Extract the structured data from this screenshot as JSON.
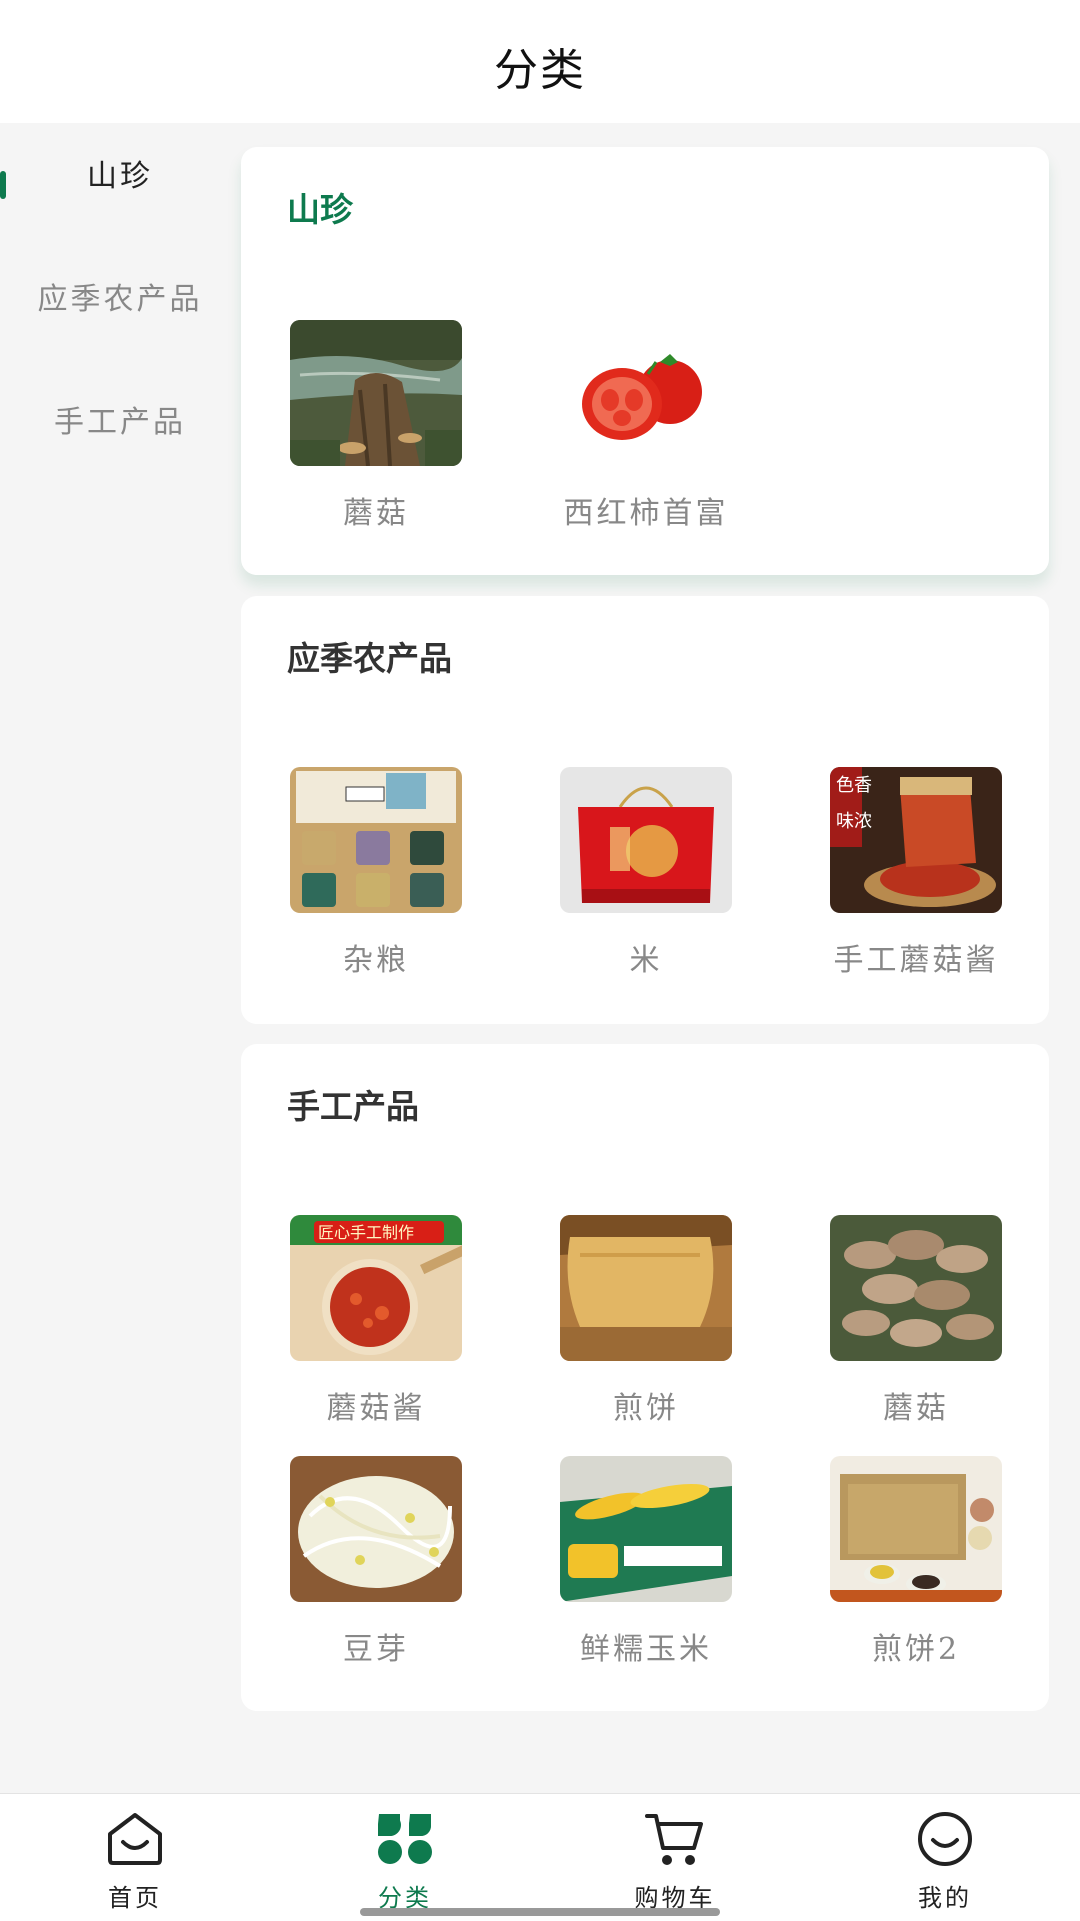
{
  "header": {
    "title": "分类"
  },
  "sidebar": {
    "items": [
      {
        "label": "山珍",
        "active": true
      },
      {
        "label": "应季农产品",
        "active": false
      },
      {
        "label": "手工产品",
        "active": false
      }
    ]
  },
  "sections": [
    {
      "title": "山珍",
      "items": [
        {
          "label": "蘑菇",
          "image": "mushroom-stump-photo"
        },
        {
          "label": "西红柿首富",
          "image": "tomato-photo"
        }
      ]
    },
    {
      "title": "应季农产品",
      "items": [
        {
          "label": "杂粮",
          "image": "grain-jars-gift-box-photo"
        },
        {
          "label": "米",
          "image": "red-rice-gift-bag-photo"
        },
        {
          "label": "手工蘑菇酱",
          "image": "mushroom-sauce-jar-photo",
          "image_text": "色香味浓"
        }
      ]
    },
    {
      "title": "手工产品",
      "items": [
        {
          "label": "蘑菇酱",
          "image": "chili-mushroom-sauce-bowl-photo",
          "image_text": "匠心手工制作"
        },
        {
          "label": "煎饼",
          "image": "folded-pancake-photo"
        },
        {
          "label": "蘑菇",
          "image": "mushroom-cluster-photo"
        },
        {
          "label": "豆芽",
          "image": "bean-sprouts-photo"
        },
        {
          "label": "鲜糯玉米",
          "image": "corn-box-photo"
        },
        {
          "label": "煎饼2",
          "image": "pancake-and-grains-photo"
        }
      ]
    }
  ],
  "tabbar": {
    "tabs": [
      {
        "label": "首页",
        "icon": "home-smile-icon"
      },
      {
        "label": "分类",
        "icon": "category-grid-icon",
        "active": true
      },
      {
        "label": "购物车",
        "icon": "cart-icon"
      },
      {
        "label": "我的",
        "icon": "profile-smile-icon"
      }
    ]
  },
  "colors": {
    "accent": "#0e7a4e",
    "text_muted": "#888888",
    "background": "#f5f5f5"
  }
}
